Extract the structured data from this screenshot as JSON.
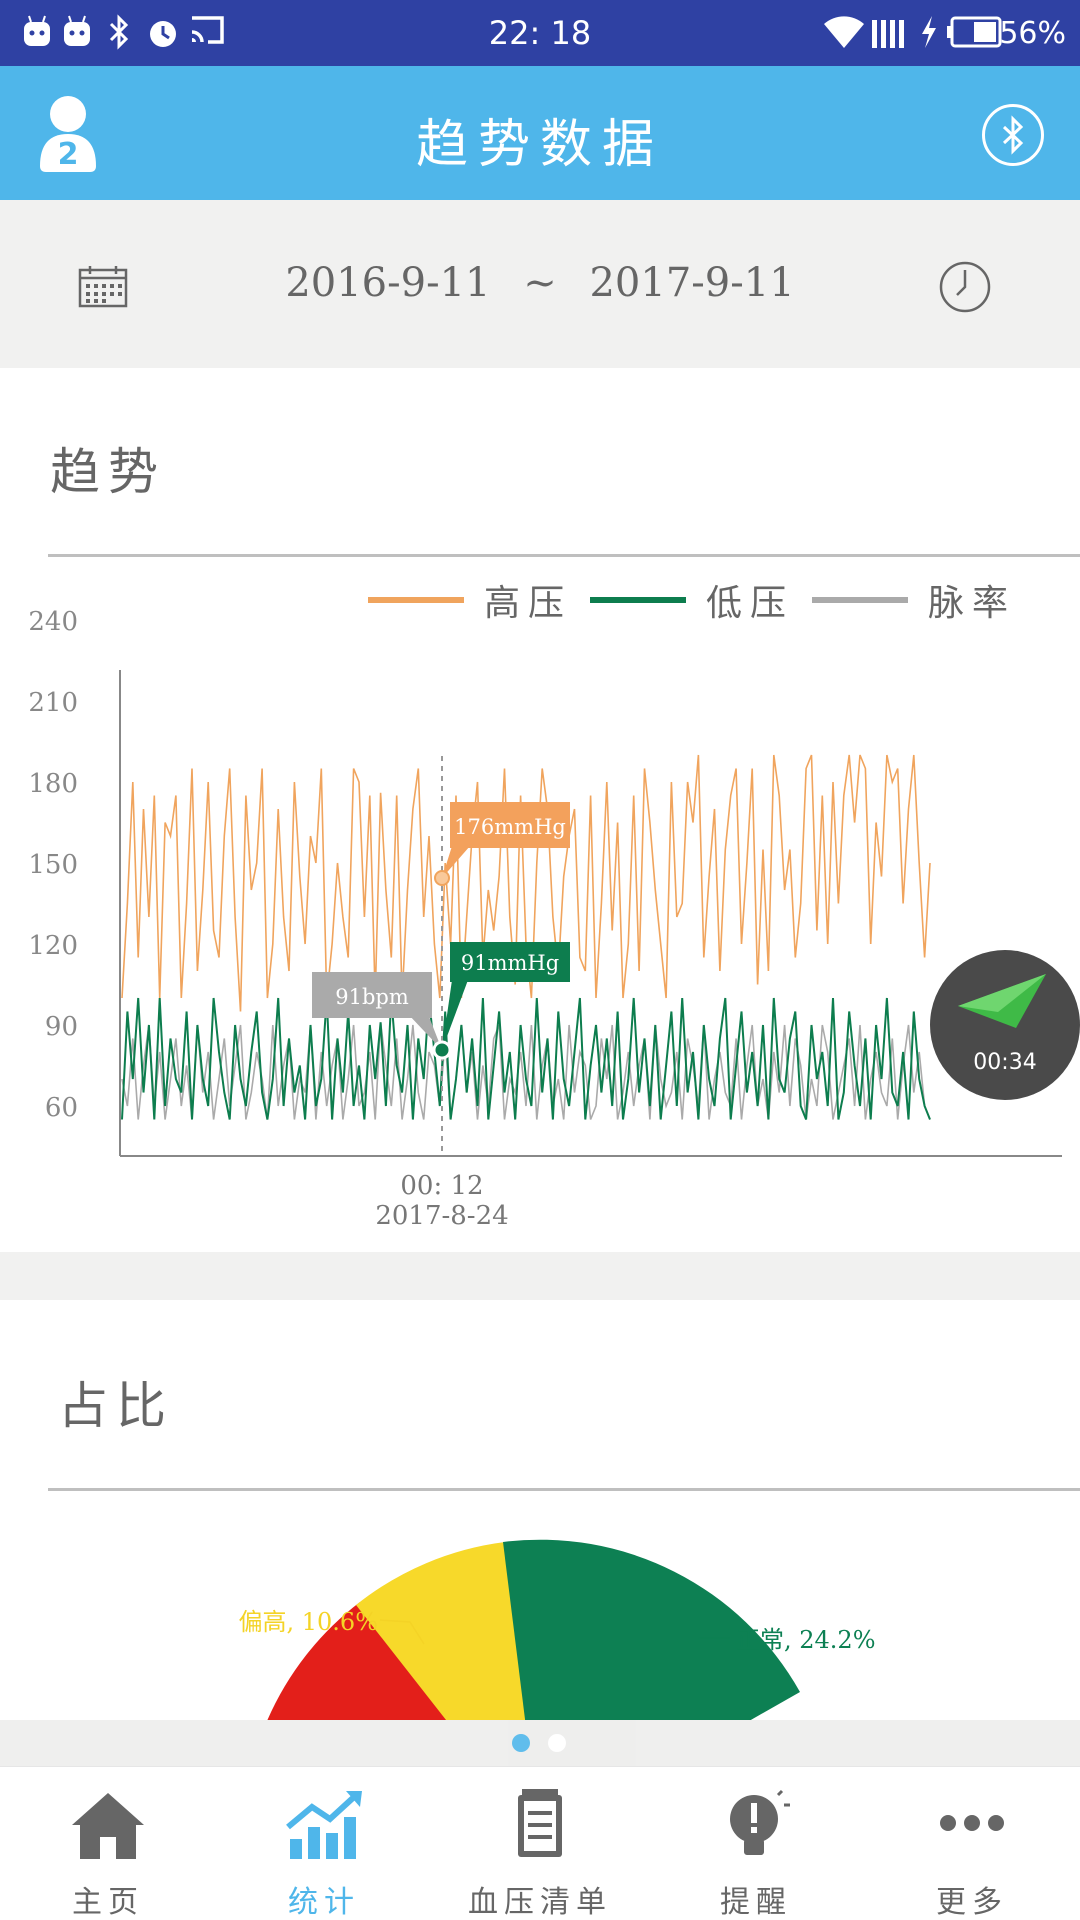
{
  "status_bar": {
    "time": "22: 18",
    "battery": "56%"
  },
  "header": {
    "title": "趋势数据"
  },
  "date_range": {
    "start": "2016-9-11",
    "separator": "~",
    "end": "2017-9-11"
  },
  "trend": {
    "title": "趋势",
    "legend": [
      {
        "label": "高压",
        "color": "#f0a45d"
      },
      {
        "label": "低压",
        "color": "#0d7d4e"
      },
      {
        "label": "脉率",
        "color": "#aaaaaa"
      }
    ],
    "y_ticks": [
      "240",
      "210",
      "180",
      "150",
      "120",
      "90",
      "60"
    ],
    "cursor": {
      "time": "00: 12",
      "date": "2017-8-24",
      "systolic_label": "176mmHg",
      "diastolic_label": "91mmHg",
      "pulse_label": "91bpm"
    }
  },
  "chart_data": {
    "type": "line",
    "ylim": [
      45,
      260
    ],
    "yticks": [
      60,
      90,
      120,
      150,
      180,
      210,
      240
    ],
    "highlight_index": 48,
    "series": [
      {
        "name": "高压",
        "color": "#f0a45d",
        "values": [
          100,
          135,
          180,
          115,
          170,
          130,
          175,
          100,
          165,
          160,
          175,
          100,
          135,
          185,
          110,
          140,
          180,
          125,
          115,
          160,
          185,
          130,
          95,
          175,
          140,
          150,
          185,
          100,
          120,
          170,
          130,
          110,
          180,
          145,
          120,
          160,
          150,
          185,
          100,
          120,
          150,
          130,
          115,
          185,
          180,
          130,
          175,
          100,
          176,
          140,
          115,
          175,
          100,
          140,
          170,
          185,
          130,
          160,
          120,
          100,
          150,
          120,
          175,
          100,
          130,
          160,
          180,
          115,
          140,
          125,
          145,
          185,
          130,
          105,
          175,
          120,
          100,
          150,
          185,
          170,
          130,
          110,
          145,
          160,
          170,
          115,
          110,
          175,
          100,
          135,
          180,
          125,
          165,
          100,
          120,
          175,
          110,
          185,
          165,
          140,
          120,
          100,
          180,
          130,
          135,
          180,
          165,
          190,
          115,
          145,
          170,
          110,
          155,
          175,
          185,
          120,
          150,
          185,
          105,
          155,
          110,
          190,
          175,
          140,
          155,
          115,
          135,
          185,
          190,
          125,
          175,
          120,
          180,
          135,
          175,
          190,
          165,
          190,
          185,
          120,
          165,
          145,
          190,
          180,
          185,
          135,
          170,
          190,
          150,
          115,
          150
        ]
      },
      {
        "name": "低压",
        "color": "#0d7d4e",
        "values": [
          55,
          95,
          70,
          100,
          65,
          90,
          55,
          100,
          60,
          85,
          70,
          65,
          95,
          55,
          90,
          70,
          60,
          100,
          80,
          65,
          55,
          90,
          70,
          60,
          80,
          95,
          65,
          55,
          70,
          100,
          60,
          85,
          65,
          75,
          55,
          90,
          60,
          70,
          100,
          55,
          85,
          65,
          95,
          60,
          75,
          55,
          90,
          70,
          91,
          60,
          100,
          75,
          65,
          90,
          55,
          85,
          70,
          100,
          80,
          60,
          95,
          55,
          70,
          90,
          65,
          85,
          60,
          100,
          55,
          75,
          95,
          65,
          80,
          55,
          90,
          70,
          60,
          100,
          65,
          85,
          55,
          95,
          70,
          60,
          80,
          100,
          55,
          75,
          90,
          65,
          85,
          60,
          95,
          55,
          70,
          100,
          65,
          85,
          60,
          90,
          55,
          75,
          95,
          60,
          100,
          65,
          80,
          55,
          90,
          70,
          60,
          85,
          100,
          55,
          75,
          95,
          65,
          80,
          60,
          90,
          55,
          100,
          70,
          65,
          85,
          95,
          60,
          55,
          90,
          70,
          80,
          60,
          100,
          55,
          65,
          95,
          75,
          60,
          85,
          55,
          90,
          70,
          100,
          65,
          60,
          80,
          55,
          95,
          70,
          60,
          55
        ]
      },
      {
        "name": "脉率",
        "color": "#aaaaaa",
        "values": [
          70,
          60,
          85,
          55,
          75,
          90,
          60,
          80,
          55,
          70,
          85,
          60,
          75,
          55,
          90,
          65,
          80,
          55,
          70,
          85,
          60,
          75,
          90,
          55,
          65,
          80,
          70,
          55,
          90,
          60,
          75,
          85,
          55,
          70,
          65,
          90,
          55,
          80,
          60,
          75,
          85,
          55,
          70,
          90,
          60,
          65,
          80,
          55,
          91,
          75,
          60,
          85,
          55,
          70,
          90,
          65,
          55,
          80,
          75,
          60,
          85,
          55,
          70,
          90,
          65,
          80,
          55,
          75,
          60,
          85,
          90,
          55,
          70,
          65,
          80,
          60,
          90,
          55,
          75,
          85,
          60,
          70,
          55,
          90,
          65,
          80,
          75,
          55,
          60,
          85,
          70,
          90,
          55,
          65,
          80,
          60,
          75,
          85,
          55,
          90,
          70,
          60,
          65,
          80,
          55,
          85,
          75,
          60,
          90,
          55,
          70,
          80,
          65,
          60,
          85,
          55,
          75,
          90,
          60,
          70,
          55,
          80,
          65,
          90,
          60,
          85,
          75,
          55,
          70,
          60,
          90,
          80,
          55,
          65,
          75,
          85,
          60,
          90,
          55,
          70,
          80,
          65,
          60,
          85,
          55,
          75,
          90,
          65,
          80,
          60,
          55
        ]
      }
    ]
  },
  "ratio": {
    "title": "占比",
    "labels": [
      {
        "text": "偏高, 10.6%",
        "color": "#f4d326"
      },
      {
        "text": "正常, 24.2%",
        "color": "#0d8053"
      }
    ]
  },
  "floating": {
    "time": "00:34"
  },
  "nav": [
    {
      "label": "主页",
      "icon": "home-icon",
      "active": false
    },
    {
      "label": "统计",
      "icon": "chart-icon",
      "active": true
    },
    {
      "label": "血压清单",
      "icon": "list-icon",
      "active": false
    },
    {
      "label": "提醒",
      "icon": "bulb-icon",
      "active": false
    },
    {
      "label": "更多",
      "icon": "more-icon",
      "active": false
    }
  ],
  "colors": {
    "status_bar": "#2f41a3",
    "header": "#4fb6ea",
    "accent": "#4fb6ea",
    "systolic": "#f0a45d",
    "diastolic": "#0d7d4e",
    "pulse": "#aaaaaa"
  }
}
